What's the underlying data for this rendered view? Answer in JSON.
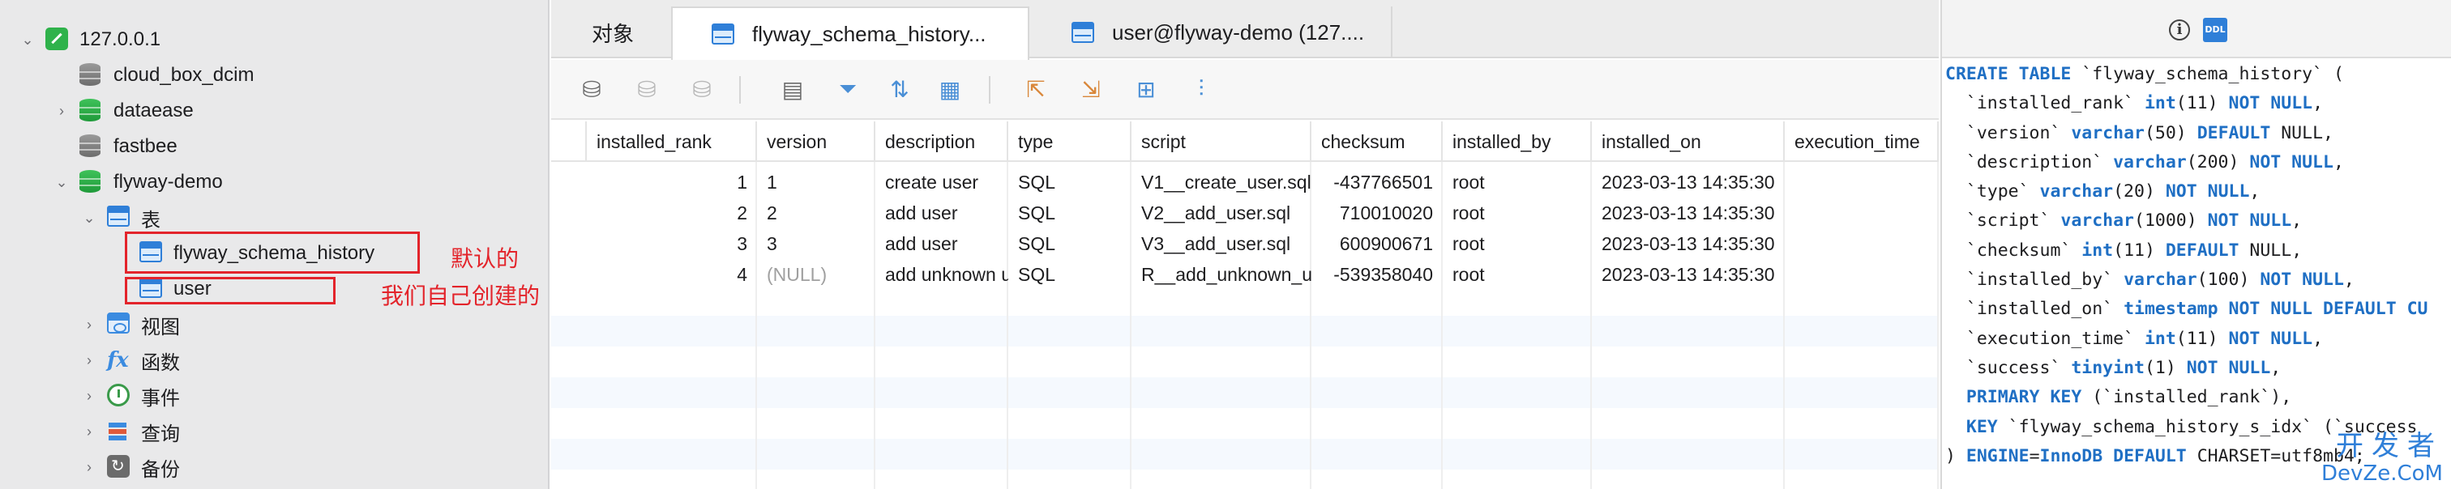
{
  "sidebar": {
    "connection": "127.0.0.1",
    "databases": [
      {
        "name": "cloud_box_dcim"
      },
      {
        "name": "dataease"
      },
      {
        "name": "fastbee"
      },
      {
        "name": "flyway-demo"
      }
    ],
    "tables_folder": "表",
    "tables": [
      "flyway_schema_history",
      "user"
    ],
    "folders": [
      "视图",
      "函数",
      "事件",
      "查询",
      "备份"
    ]
  },
  "annotations": {
    "default_label": "默认的",
    "created_label": "我们自己创建的"
  },
  "tabs": [
    {
      "label": "对象"
    },
    {
      "label": "flyway_schema_history..."
    },
    {
      "label": "user@flyway-demo (127...."
    }
  ],
  "grid": {
    "columns": [
      "installed_rank",
      "version",
      "description",
      "type",
      "script",
      "checksum",
      "installed_by",
      "installed_on",
      "execution_time"
    ],
    "rows": [
      [
        "1",
        "1",
        "create user",
        "SQL",
        "V1__create_user.sql",
        "-437766501",
        "root",
        "2023-03-13 14:35:30"
      ],
      [
        "2",
        "2",
        "add user",
        "SQL",
        "V2__add_user.sql",
        "710010020",
        "root",
        "2023-03-13 14:35:30"
      ],
      [
        "3",
        "3",
        "add user",
        "SQL",
        "V3__add_user.sql",
        "600900671",
        "root",
        "2023-03-13 14:35:30"
      ],
      [
        "4",
        "(NULL)",
        "add unknown u",
        "SQL",
        "R__add_unknown_u",
        "-539358040",
        "root",
        "2023-03-13 14:35:30"
      ]
    ]
  },
  "ddl": {
    "icon_label": "DDL",
    "lines": [
      "CREATE TABLE `flyway_schema_history` (",
      "  `installed_rank` int(11) NOT NULL,",
      "  `version` varchar(50) DEFAULT NULL,",
      "  `description` varchar(200) NOT NULL,",
      "  `type` varchar(20) NOT NULL,",
      "  `script` varchar(1000) NOT NULL,",
      "  `checksum` int(11) DEFAULT NULL,",
      "  `installed_by` varchar(100) NOT NULL,",
      "  `installed_on` timestamp NOT NULL DEFAULT CU",
      "  `execution_time` int(11) NOT NULL,",
      "  `success` tinyint(1) NOT NULL,",
      "  PRIMARY KEY (`installed_rank`),",
      "  KEY `flyway_schema_history_s_idx` (`success",
      ") ENGINE=InnoDB DEFAULT CHARSET=utf8mb4;"
    ]
  },
  "watermark": {
    "line1": "开发者",
    "line2": "DevZe.CoM"
  },
  "colors": {
    "accent": "#2f7fd8",
    "annotation": "#e3242b",
    "keyword": "#1f6fc4"
  }
}
